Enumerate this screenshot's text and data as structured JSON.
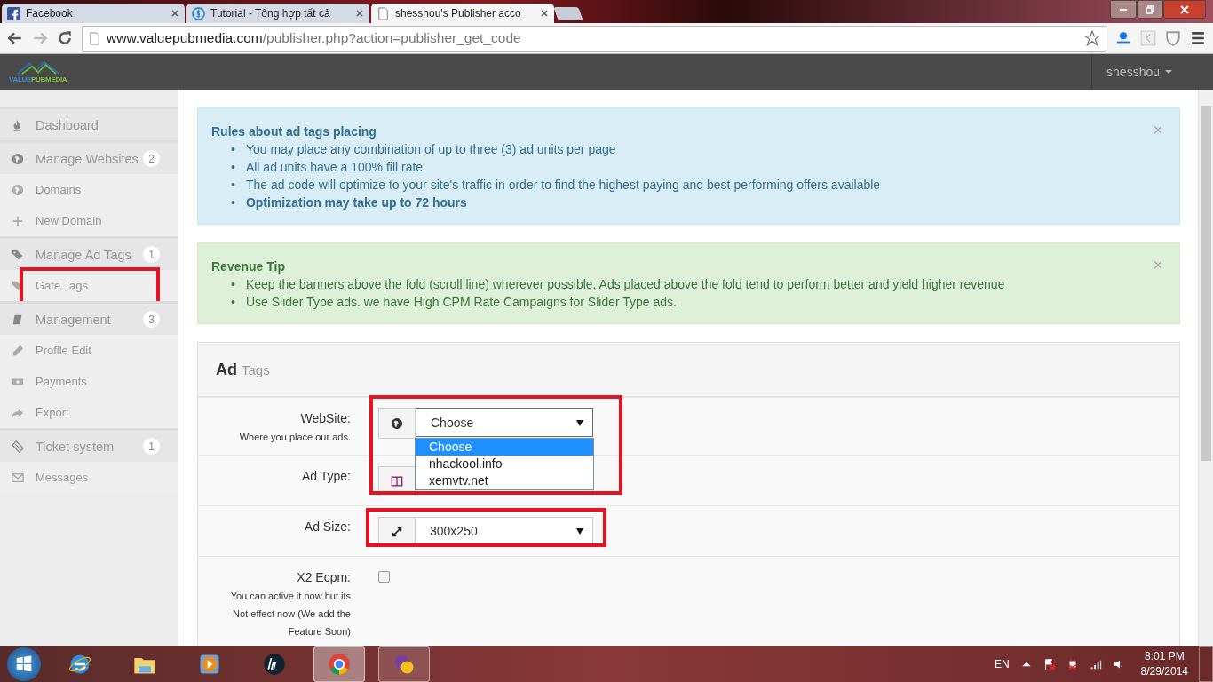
{
  "browser": {
    "tabs": [
      {
        "title": "Facebook",
        "selected": false,
        "kind": "facebook"
      },
      {
        "title": "Tutorial - Tổng hợp tất cả",
        "selected": false,
        "kind": "coin"
      },
      {
        "title": "shesshou's Publisher acco",
        "selected": true,
        "kind": "page"
      }
    ],
    "url": {
      "host": "www.valuepubmedia.com",
      "path": "/publisher.php?action=publisher_get_code"
    }
  },
  "header": {
    "logo": [
      "VALUE",
      "PUBMEDIA"
    ],
    "user": "shesshou"
  },
  "sidebar": {
    "items": [
      {
        "label": "Dashboard",
        "kind": "section"
      },
      {
        "label": "Manage Websites",
        "kind": "section",
        "badge": "2"
      },
      {
        "label": "Domains",
        "kind": "sub"
      },
      {
        "label": "New Domain",
        "kind": "sub"
      },
      {
        "label": "Manage Ad Tags",
        "kind": "section",
        "badge": "1"
      },
      {
        "label": "Gate Tags",
        "kind": "sub",
        "highlighted": true
      },
      {
        "label": "Management",
        "kind": "section",
        "badge": "3"
      },
      {
        "label": "Profile Edit",
        "kind": "sub"
      },
      {
        "label": "Payments",
        "kind": "sub"
      },
      {
        "label": "Export",
        "kind": "sub"
      },
      {
        "label": "Ticket system",
        "kind": "section",
        "badge": "1"
      },
      {
        "label": "Messages",
        "kind": "sub"
      }
    ]
  },
  "alerts": [
    {
      "kind": "info",
      "title": "Rules about ad tags placing",
      "close": "×",
      "bullet": "•",
      "items": [
        {
          "text": "You may place any combination of up to three (3) ad units per page",
          "bold": false
        },
        {
          "text": "All ad units have a 100% fill rate",
          "bold": false
        },
        {
          "text": "The ad code will optimize to your site's traffic in order to find the highest paying and best performing offers available",
          "bold": false
        },
        {
          "text": "Optimization may take up to 72 hours",
          "bold": true
        }
      ]
    },
    {
      "kind": "success",
      "title": "Revenue Tip",
      "close": "×",
      "bullet": "•",
      "items": [
        {
          "text": "Keep the banners above the fold (scroll line) wherever possible. Ads placed above the fold tend to perform better and yield higher revenue",
          "bold": false
        },
        {
          "text": "Use Slider Type ads. we have High CPM Rate Campaigns for Slider Type ads.",
          "bold": false
        }
      ]
    }
  ],
  "panel": {
    "title": "Ad",
    "subtitle": "Tags",
    "fields": [
      {
        "label": "WebSite:",
        "hint": "Where you place our ads.",
        "kind": "select",
        "value": "Choose",
        "open": true,
        "options": [
          {
            "text": "Choose",
            "selected": true
          },
          {
            "text": "nhackool.info",
            "selected": false
          },
          {
            "text": "xemvtv.net",
            "selected": false
          }
        ]
      },
      {
        "label": "Ad Type:",
        "kind": "select",
        "open": false
      },
      {
        "label": "Ad Size:",
        "kind": "select",
        "value": "300x250",
        "open": false
      },
      {
        "label": "X2 Ecpm:",
        "hint": "You can active it now but its Not effect now (We add the Feature Soon)",
        "kind": "checkbox",
        "checked": false
      }
    ]
  },
  "taskbar": {
    "apps": [
      {
        "kind": "ie",
        "selected": false,
        "open": false
      },
      {
        "kind": "folder",
        "selected": false,
        "open": false
      },
      {
        "kind": "media",
        "selected": false,
        "open": false
      },
      {
        "kind": "hp",
        "selected": false,
        "open": false
      },
      {
        "kind": "chrome",
        "selected": true,
        "open": true
      },
      {
        "kind": "messenger",
        "selected": false,
        "open": true
      }
    ],
    "language": "EN",
    "time": "8:01 PM",
    "date": "8/29/2014"
  }
}
